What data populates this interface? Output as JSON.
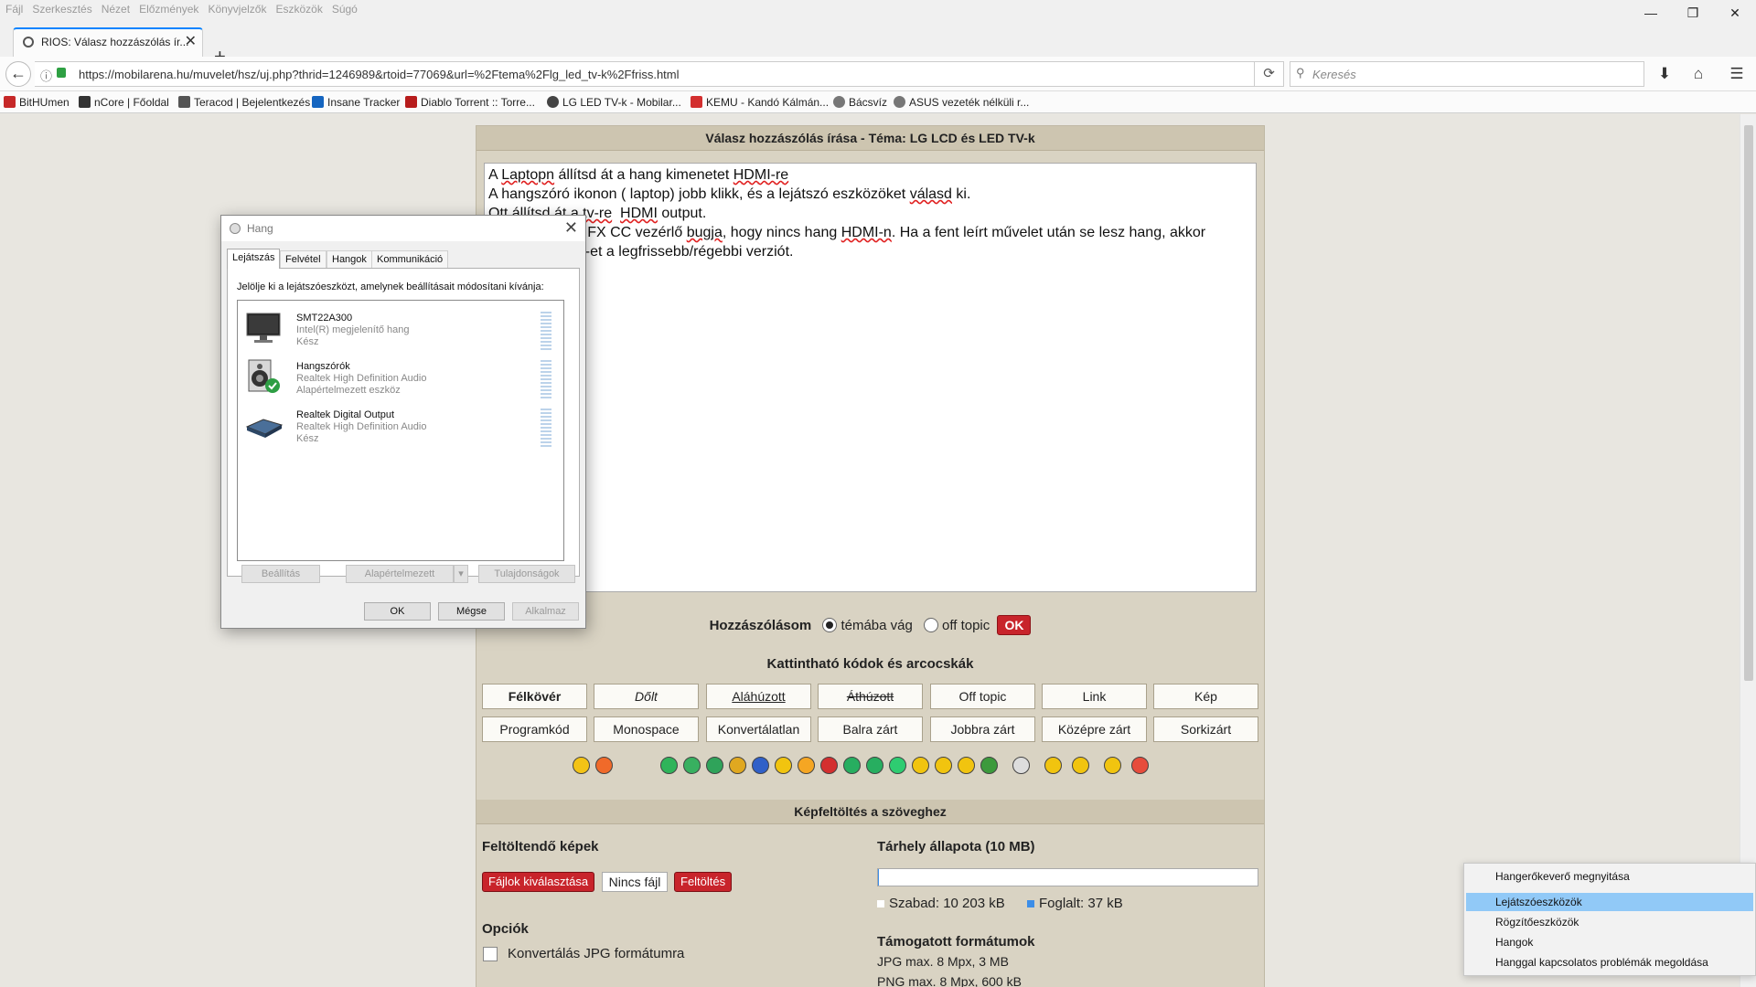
{
  "menubar": [
    "Fájl",
    "Szerkesztés",
    "Nézet",
    "Előzmények",
    "Könyvjelzők",
    "Eszközök",
    "Súgó"
  ],
  "window_controls": {
    "minimize": "—",
    "maximize": "❐",
    "close": "✕"
  },
  "tab": {
    "title": "RIOS: Válasz hozzászólás ír...",
    "close": "✕",
    "new_tab": "+"
  },
  "nav": {
    "url": "https://mobilarena.hu/muvelet/hsz/uj.php?thrid=1246989&rtoid=77069&url=%2Ftema%2Flg_led_tv-k%2Ffriss.html",
    "search_placeholder": "Keresés",
    "reload": "⟳",
    "back": "←",
    "download": "⬇",
    "home": "⌂",
    "menu": "☰",
    "info": "ⓘ",
    "search_icon": "⚲"
  },
  "bookmarks": [
    {
      "label": "BitHUmen",
      "color": "#c62828"
    },
    {
      "label": "nCore | Főoldal",
      "color": "#333333"
    },
    {
      "label": "Teracod | Bejelentkezés",
      "color": "#555555"
    },
    {
      "label": "Insane Tracker",
      "color": "#1565c0"
    },
    {
      "label": "Diablo Torrent :: Torre...",
      "color": "#b71c1c"
    },
    {
      "label": "LG LED TV-k - Mobilar...",
      "color": "#444444"
    },
    {
      "label": "KEMU - Kandó Kálmán...",
      "color": "#d32f2f"
    },
    {
      "label": "Bácsvíz",
      "color": "#777777"
    },
    {
      "label": "ASUS vezeték nélküli r...",
      "color": "#777777"
    }
  ],
  "page": {
    "reply_header": "Válasz hozzászólás írása - Téma: LG LCD és LED TV-k",
    "textarea_lines": [
      [
        {
          "t": "A "
        },
        {
          "t": "Laptopn",
          "sp": true
        },
        {
          "t": " állítsd át a hang kimenetet "
        },
        {
          "t": "HDMI-re",
          "sp": true
        }
      ],
      [
        {
          "t": "A hangszóró ikonon ( laptop) jobb klikk, és a lejátszó eszközöket "
        },
        {
          "t": "válasd",
          "sp": true
        },
        {
          "t": " ki."
        }
      ],
      [
        {
          "t": "Ott állítsd át a "
        },
        {
          "t": "tv-re",
          "sp": true
        },
        {
          "t": "  "
        },
        {
          "t": "HDMI",
          "sp": true
        },
        {
          "t": " output."
        }
      ],
      [
        {
          "t": "Vagy az "
        },
        {
          "t": "Intel",
          "sp": true
        },
        {
          "t": " GFX CC vezérlő "
        },
        {
          "t": "bugja",
          "sp": true
        },
        {
          "t": ", hogy nincs hang "
        },
        {
          "t": "HDMI-n",
          "sp": true
        },
        {
          "t": ". Ha a fent leírt művelet után se lesz hang, akkor"
        }
      ],
      [
        {
          "t": "frissítsd a GFX-et a legfrissebb/régebbi verziót."
        }
      ]
    ],
    "post_as_label": "Hozzászólásom",
    "post_as_on": "témába vág",
    "post_as_off": "off topic",
    "ok_label": "OK",
    "codes_title": "Kattintható kódok és arcocskák",
    "code_buttons_row1": [
      "Félkövér",
      "Dőlt",
      "Aláhúzott",
      "Áthúzott",
      "Off topic",
      "Link",
      "Kép"
    ],
    "code_buttons_row2": [
      "Programkód",
      "Monospace",
      "Konvertálatlan",
      "Balra zárt",
      "Jobbra zárt",
      "Középre zárt",
      "Sorkizárt"
    ],
    "smiley_colors": [
      "#f3c316",
      "#f06a2a",
      "#2fb45a",
      "#38b060",
      "#2fa35a",
      "#e0a820",
      "#3060c8",
      "#f1c40f",
      "#f5a623",
      "#d32f2f",
      "#27ae60",
      "#27ae60",
      "#2ecc71",
      "#f1c40f",
      "#f1c40f",
      "#f1c40f",
      "#3c9a3c",
      "#dddddd",
      "#f1c40f",
      "#f1c40f",
      "#f1c40f",
      "#e74c3c"
    ],
    "upload_header": "Képfeltöltés a szöveghez",
    "images_title": "Feltöltendő képek",
    "choose_files": "Fájlok kiválasztása",
    "no_file": "Nincs fájl",
    "upload_btn": "Feltöltés",
    "storage_title": "Tárhely állapota (10 MB)",
    "storage_used_fraction": 0.0036,
    "free_label": "Szabad: 10 203 kB",
    "used_label": "Foglalt: 37 kB",
    "options_title": "Opciók",
    "convert_jpg": "Konvertálás JPG formátumra",
    "formats_title": "Támogatott formátumok",
    "format_jpg": "JPG max. 8 Mpx, 3 MB",
    "format_png": "PNG max. 8 Mpx, 600 kB"
  },
  "dialog": {
    "title": "Hang",
    "tabs": [
      "Lejátszás",
      "Felvétel",
      "Hangok",
      "Kommunikáció"
    ],
    "prompt": "Jelölje ki a lejátszóeszközt, amelynek beállításait módosítani kívánja:",
    "devices": [
      {
        "name": "SMT22A300",
        "l2": "Intel(R) megjelenítő hang",
        "l3": "Kész"
      },
      {
        "name": "Hangszórók",
        "l2": "Realtek High Definition Audio",
        "l3": "Alapértelmezett eszköz"
      },
      {
        "name": "Realtek Digital Output",
        "l2": "Realtek High Definition Audio",
        "l3": "Kész"
      }
    ],
    "btn_settings": "Beállítás",
    "btn_default": "Alapértelmezett",
    "btn_properties": "Tulajdonságok",
    "btn_ok": "OK",
    "btn_cancel": "Mégse",
    "btn_apply": "Alkalmaz"
  },
  "context_menu": {
    "items": [
      "Hangerőkeverő megnyitása",
      "Lejátszóeszközök",
      "Rögzítőeszközök",
      "Hangok",
      "Hanggal kapcsolatos problémák megoldása"
    ],
    "highlighted": 1
  }
}
